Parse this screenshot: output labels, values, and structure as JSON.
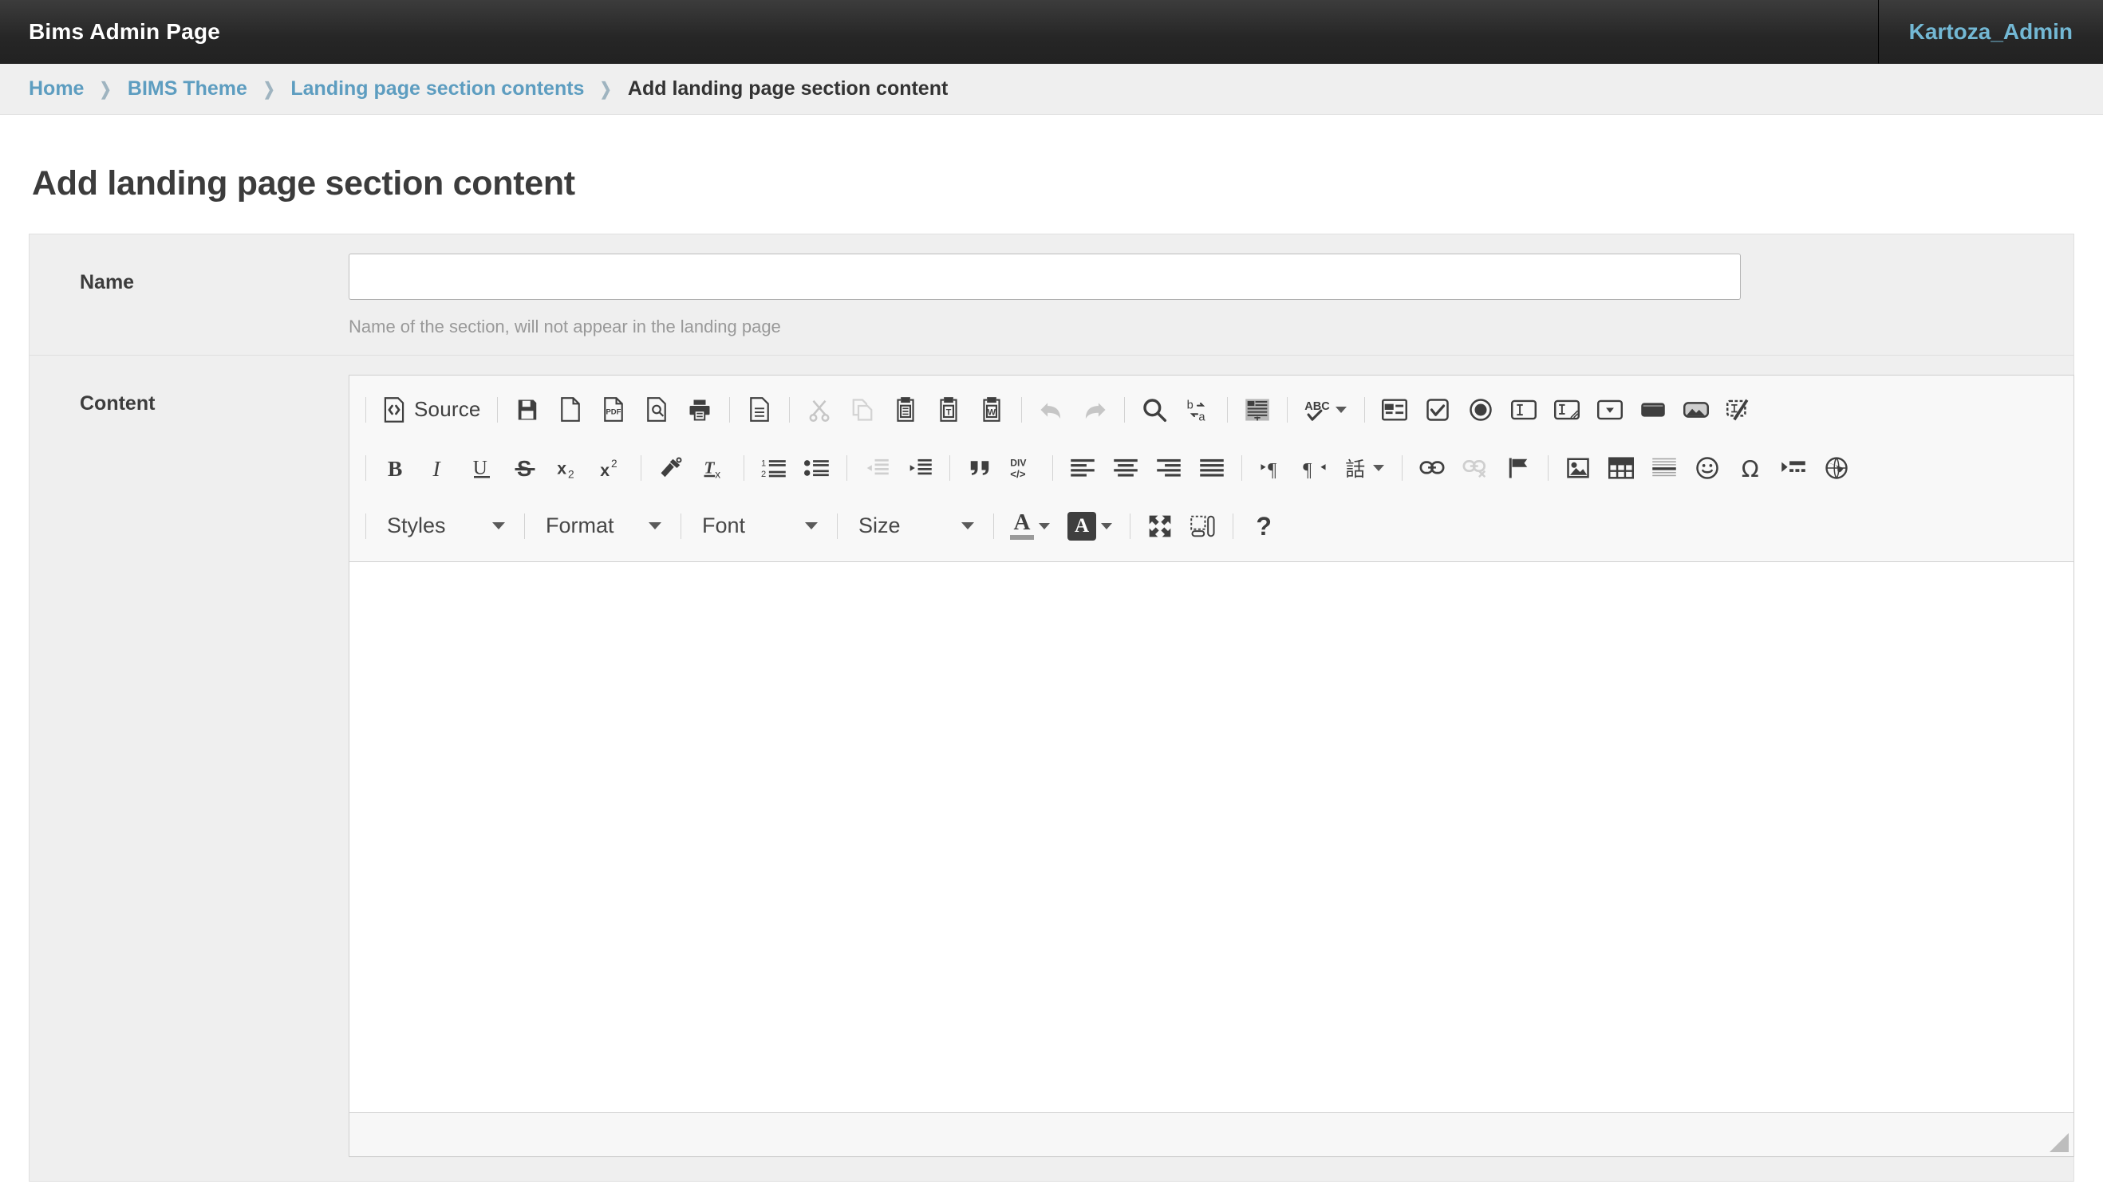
{
  "header": {
    "brand": "Bims Admin Page",
    "user": "Kartoza_Admin"
  },
  "breadcrumbs": {
    "separator": "❯",
    "items": [
      {
        "label": "Home",
        "current": false
      },
      {
        "label": "BIMS Theme",
        "current": false
      },
      {
        "label": "Landing page section contents",
        "current": false
      },
      {
        "label": "Add landing page section content",
        "current": true
      }
    ]
  },
  "page": {
    "title": "Add landing page section content"
  },
  "form": {
    "name": {
      "label": "Name",
      "value": "",
      "placeholder": "",
      "help": "Name of the section, will not appear in the landing page"
    },
    "content": {
      "label": "Content",
      "value": ""
    }
  },
  "editor": {
    "source_label": "Source",
    "combos": {
      "styles": "Styles",
      "format": "Format",
      "font": "Font",
      "size": "Size"
    },
    "toolbar_rows": [
      [
        "source-button",
        "save-icon",
        "new-page-icon",
        "export-pdf-icon",
        "preview-icon",
        "print-icon",
        "templates-icon",
        "cut-icon",
        "copy-icon",
        "paste-icon",
        "paste-text-icon",
        "paste-word-icon",
        "undo-icon",
        "redo-icon",
        "find-icon",
        "replace-icon",
        "select-all-icon",
        "spellcheck-icon",
        "form-icon",
        "checkbox-icon",
        "radio-icon",
        "text-field-icon",
        "textarea-icon",
        "select-field-icon",
        "button-icon",
        "image-button-icon",
        "hidden-field-icon"
      ],
      [
        "bold-icon",
        "italic-icon",
        "underline-icon",
        "strikethrough-icon",
        "subscript-icon",
        "superscript-icon",
        "copy-formatting-icon",
        "remove-format-icon",
        "numbered-list-icon",
        "bulleted-list-icon",
        "outdent-icon",
        "indent-icon",
        "blockquote-icon",
        "div-container-icon",
        "align-left-icon",
        "align-center-icon",
        "align-right-icon",
        "justify-icon",
        "ltr-icon",
        "rtl-icon",
        "language-icon",
        "link-icon",
        "unlink-icon",
        "anchor-icon",
        "image-icon",
        "table-icon",
        "horizontal-rule-icon",
        "smiley-icon",
        "special-char-icon",
        "page-break-icon",
        "iframe-icon"
      ],
      [
        "styles-combo",
        "format-combo",
        "font-combo",
        "size-combo",
        "text-color-icon",
        "bg-color-icon",
        "maximize-icon",
        "show-blocks-icon",
        "about-icon"
      ]
    ],
    "disabled_buttons": [
      "cut-icon",
      "copy-icon",
      "undo-icon",
      "redo-icon",
      "outdent-icon",
      "unlink-icon"
    ],
    "about_label": "?",
    "color_letter": "A",
    "special_char": "Ω",
    "div_label": "DIV",
    "spell_label": "ABC",
    "language_label": "話"
  },
  "colors": {
    "header_bg": "#262626",
    "accent_link": "#5d9dc0",
    "user_link": "#73b8d4",
    "panel_bg": "#efefef",
    "toolbar_bg": "#f8f8f8",
    "border": "#d1d1d1"
  }
}
